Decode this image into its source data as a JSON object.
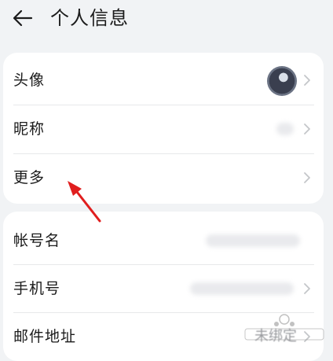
{
  "header": {
    "title": "个人信息",
    "back_icon": "arrow-left-icon"
  },
  "group1": {
    "items": [
      {
        "label": "头像"
      },
      {
        "label": "昵称"
      },
      {
        "label": "更多"
      }
    ]
  },
  "group2": {
    "items": [
      {
        "label": "帐号名"
      },
      {
        "label": "手机号"
      },
      {
        "label": "邮件地址",
        "value": "未绑定"
      }
    ]
  },
  "annotation": {
    "color": "#e01e1e"
  }
}
